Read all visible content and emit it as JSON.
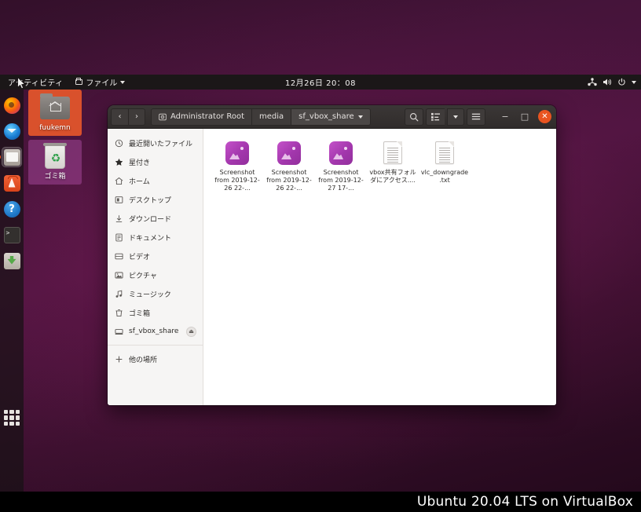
{
  "topbar": {
    "activities": "アクティビティ",
    "app_menu": "ファイル",
    "clock": "12月26日  20：08",
    "indicators": [
      "network-icon",
      "volume-icon",
      "power-icon",
      "chevron-down-icon"
    ]
  },
  "dock": {
    "items": [
      {
        "name": "firefox",
        "label": "Firefox",
        "active": false
      },
      {
        "name": "thunderbird",
        "label": "Thunderbird Mail",
        "active": false
      },
      {
        "name": "files",
        "label": "ファイル",
        "active": true
      },
      {
        "name": "software",
        "label": "Ubuntu Software",
        "active": false
      },
      {
        "name": "help",
        "label": "ヘルプ",
        "active": false
      },
      {
        "name": "terminal",
        "label": "端末",
        "active": false
      },
      {
        "name": "store",
        "label": "ソフトウェア",
        "active": false
      }
    ],
    "show_apps_label": "アプリケーションを表示する"
  },
  "desktop": {
    "icons": [
      {
        "name": "home-folder",
        "label": "fuukemn"
      },
      {
        "name": "trash",
        "label": "ゴミ箱"
      }
    ]
  },
  "window": {
    "nav": {
      "back": "‹",
      "forward": "›"
    },
    "breadcrumbs": [
      {
        "label": "Administrator Root",
        "icon": "drive-icon",
        "current": false
      },
      {
        "label": "media",
        "icon": "",
        "current": false
      },
      {
        "label": "sf_vbox_share",
        "icon": "",
        "current": true
      }
    ],
    "toolbar": {
      "search": "search-icon",
      "view_list": "list-view-icon",
      "view_dropdown": "chevron-down-icon",
      "menu": "hamburger-menu-icon"
    },
    "controls": {
      "minimize": "−",
      "maximize": "□",
      "close": "✕"
    },
    "sidebar": {
      "items": [
        {
          "icon": "clock-icon",
          "label": "最近開いたファイル"
        },
        {
          "icon": "star-icon",
          "label": "星付き"
        },
        {
          "icon": "home-icon",
          "label": "ホーム"
        },
        {
          "icon": "desktop-icon",
          "label": "デスクトップ"
        },
        {
          "icon": "download-icon",
          "label": "ダウンロード"
        },
        {
          "icon": "document-icon",
          "label": "ドキュメント"
        },
        {
          "icon": "video-icon",
          "label": "ビデオ"
        },
        {
          "icon": "picture-icon",
          "label": "ピクチャ"
        },
        {
          "icon": "music-icon",
          "label": "ミュージック"
        },
        {
          "icon": "trash-icon",
          "label": "ゴミ箱"
        },
        {
          "icon": "drive-icon",
          "label": "sf_vbox_share",
          "eject": true
        }
      ],
      "other_locations": {
        "icon": "plus-icon",
        "label": "他の場所"
      }
    },
    "files": [
      {
        "type": "image",
        "name": "Screenshot from 2019-12-26 22-..."
      },
      {
        "type": "image",
        "name": "Screenshot from 2019-12-26 22-..."
      },
      {
        "type": "image",
        "name": "Screenshot from 2019-12-27 17-..."
      },
      {
        "type": "text",
        "name": "vbox共有フォルダにアクセス...."
      },
      {
        "type": "text",
        "name": "vlc_downgrade.txt"
      }
    ]
  },
  "caption": {
    "text": "Ubuntu 20.04 LTS on VirtualBox"
  },
  "colors": {
    "accent_orange": "#e95420",
    "panel_dark": "#1b1718",
    "sidebar_bg": "#f6f5f4",
    "headerbar": "#302c2b",
    "image_icon": "#a337ad"
  }
}
